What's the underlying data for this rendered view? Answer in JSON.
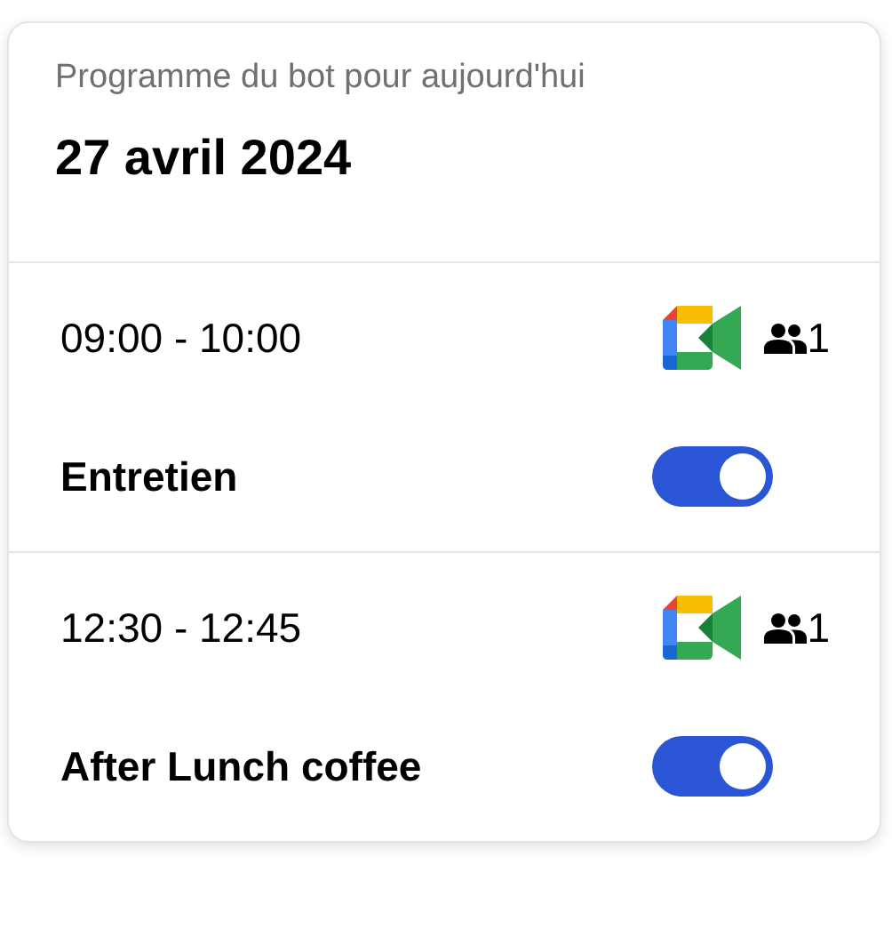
{
  "header": {
    "subtitle": "Programme du bot pour aujourd'hui",
    "date": "27 avril 2024"
  },
  "events": [
    {
      "time": "09:00 - 10:00",
      "attendees": "1",
      "name": "Entretien",
      "on": true
    },
    {
      "time": "12:30 - 12:45",
      "attendees": "1",
      "name": "After Lunch coffee",
      "on": true
    }
  ]
}
